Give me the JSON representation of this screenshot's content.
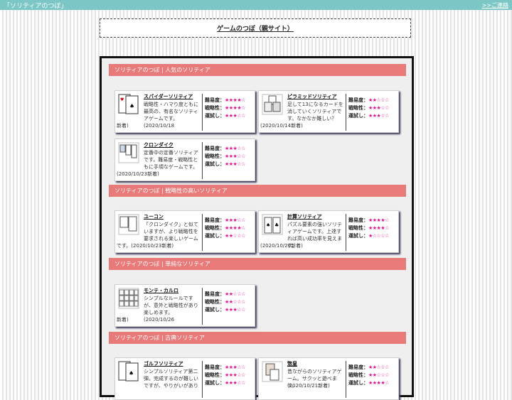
{
  "topbar": {
    "title": "「ソリティアのつぼ」",
    "contact": ">>ご連絡"
  },
  "mirror_link": "ゲームのつぼ（親サイト）",
  "labels": {
    "difficulty": "難易度：",
    "strategy": "戦略性：",
    "luck": "運試し："
  },
  "sections": [
    {
      "header": "ソリティアのつぼ | 人気のソリティア",
      "cards": [
        {
          "name": "スパイダーソリティア",
          "desc": "戦略性・ハマり度ともに最高の、有名なソリティアゲームです。(2020/10/18",
          "date": "新着)",
          "difficulty": "★★★★☆",
          "strategy": "★★★★☆",
          "luck": "★★★☆☆"
        },
        {
          "name": "ピラミッドソリティア",
          "desc": "足して13になるカードを消していくソリティアです。なかなか難しい？",
          "date": "(2020/10/14新着)",
          "difficulty": "★★☆☆☆",
          "strategy": "★★★☆☆",
          "luck": "★★★☆☆"
        },
        {
          "name": "クロンダイク",
          "desc": "定番中の定番ソリティアです。難易度・戦略性ともに手頃なゲームです。",
          "date": "(2020/10/23新着)",
          "difficulty": "★★★☆☆",
          "strategy": "★★★☆☆",
          "luck": "★★★☆☆"
        }
      ]
    },
    {
      "header": "ソリティアのつぼ | 戦略性の高いソリティア",
      "cards": [
        {
          "name": "ユーコン",
          "desc": "「クロンダイク」と似ていますが、より戦略性を要求される楽しいゲーム",
          "date": "です。(2020/10/23新着)",
          "difficulty": "★★★☆☆",
          "strategy": "★★★★☆",
          "luck": "★★☆☆☆"
        },
        {
          "name": "計算ソリティア",
          "desc": "パズル要素の強いソリティアゲームです。上達すれば高い成功率を見えます。",
          "date": "(2020/10/20新着)",
          "difficulty": "★★★★☆",
          "strategy": "★★★★☆",
          "luck": "★☆☆☆☆"
        }
      ]
    },
    {
      "header": "ソリティアのつぼ | 単純なソリティア",
      "cards": [
        {
          "name": "モンテ・カルロ",
          "desc": "シンプルなルールですが、意外と戦略性があり楽しめます。(2020/10/26",
          "date": "新着)",
          "difficulty": "★★☆☆☆",
          "strategy": "★★☆☆☆",
          "luck": "★★★☆☆"
        }
      ]
    },
    {
      "header": "ソリティアのつぼ | 古典ソリティア",
      "cards": [
        {
          "name": "ゴルフソリティア",
          "desc": "シンプルソリティア第二弾。完成するのが難しいですが、やりがいがあり",
          "date": "",
          "difficulty": "★★★☆☆",
          "strategy": "★★★☆☆",
          "luck": "★★★☆☆"
        },
        {
          "name": "惣皇",
          "desc": "昔ながらのソリティアゲーム。サクッと遊べます。",
          "date": "(2020/10/21新着)",
          "difficulty": "★★☆☆☆",
          "strategy": "★★☆☆☆",
          "luck": "★★★★☆"
        }
      ]
    }
  ],
  "colors": {
    "topbar": "#7cc7c5",
    "section_header": "#e87a7a",
    "stars": "#e0138c"
  }
}
